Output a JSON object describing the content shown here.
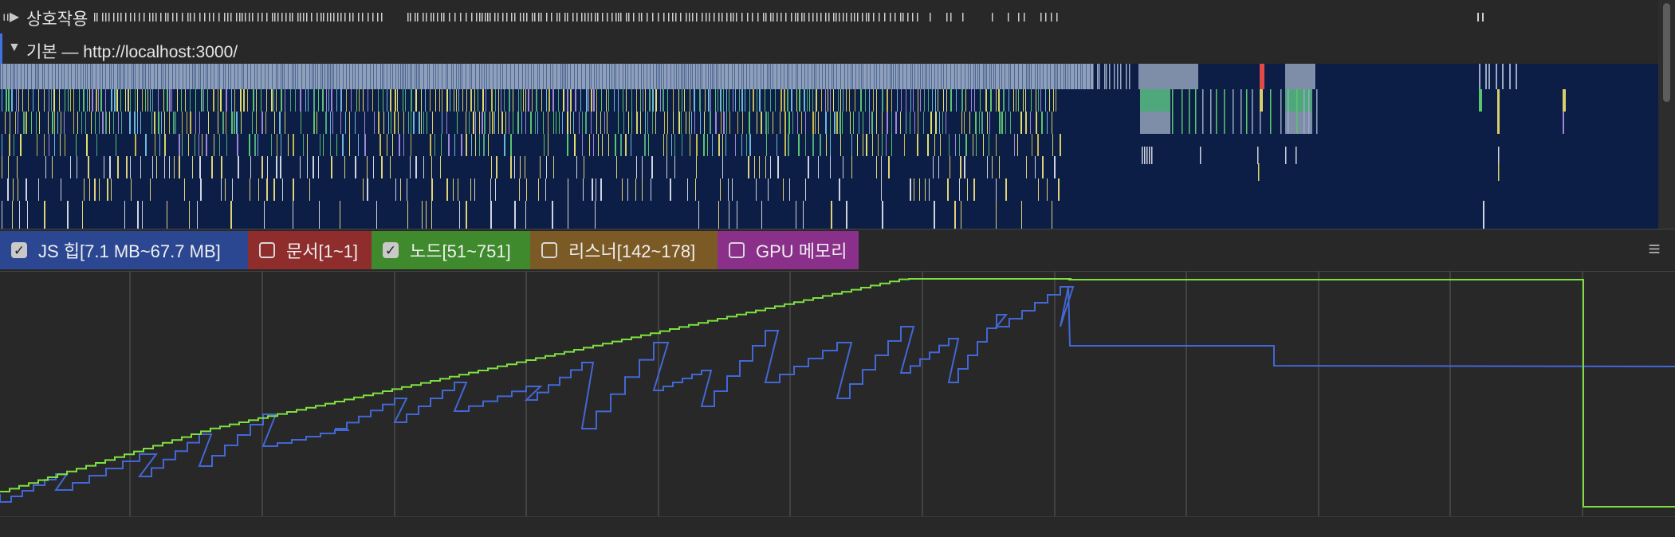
{
  "interactions": {
    "label": "상호작용"
  },
  "main_track": {
    "label": "기본 — http://localhost:3000/"
  },
  "legend": {
    "items": [
      {
        "label": "JS 힙[7.1 MB~67.7 MB]",
        "checked": true,
        "color": "#2b4791"
      },
      {
        "label": "문서[1~1]",
        "checked": false,
        "color": "#8f2d2d"
      },
      {
        "label": "노드[51~751]",
        "checked": true,
        "color": "#3f8a2c"
      },
      {
        "label": "리스너[142~178]",
        "checked": false,
        "color": "#7b5a26"
      },
      {
        "label": "GPU 메모리",
        "checked": false,
        "color": "#8a2f8a"
      }
    ]
  },
  "menu": {
    "icon": "hamburger-menu-icon"
  },
  "colors": {
    "flame_background": "#0c1e45",
    "js_heap_line": "#4267d6",
    "nodes_line": "#7ee040",
    "grid": "#4a4a4a"
  }
}
